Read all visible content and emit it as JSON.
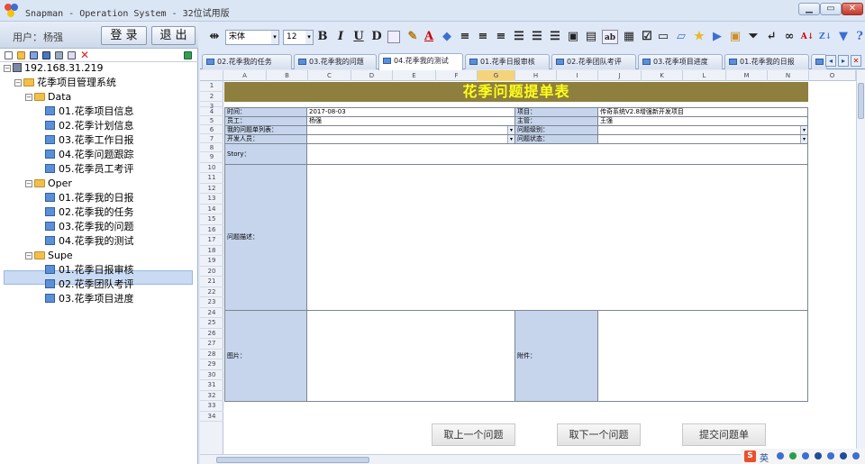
{
  "window": {
    "title": "Snapman - Operation System - 32位试用版",
    "minimize": "▭",
    "maximize": "▭",
    "close": "✕"
  },
  "login": {
    "user_label": "用户：",
    "user_name": "杨强",
    "login_btn": "登 录",
    "logout_btn": "退 出"
  },
  "tree": {
    "root": "192.168.31.219",
    "system": "花季项目管理系统",
    "groups": [
      {
        "name": "Data",
        "items": [
          "01.花季项目信息",
          "02.花季计划信息",
          "03.花季工作日报",
          "04.花季问题跟踪",
          "05.花季员工考评"
        ]
      },
      {
        "name": "Oper",
        "items": [
          "01.花季我的日报",
          "02.花季我的任务",
          "03.花季我的问题",
          "04.花季我的测试"
        ]
      },
      {
        "name": "Supe",
        "items": [
          "01.花季日报审核",
          "02.花季团队考评",
          "03.花季项目进度"
        ]
      }
    ]
  },
  "toolbar": {
    "font_name": "宋体",
    "font_size": "12",
    "bold": "B",
    "italic": "I",
    "underline": "U",
    "strike": "D",
    "font_color": "A",
    "abbr": "ab"
  },
  "tabs": [
    "02.花季我的任务",
    "03.花季我的问题",
    "04.花季我的测试",
    "01.花季日报审核",
    "02.花季团队考评",
    "03.花季项目进度",
    "01.花季我的日报"
  ],
  "sheet": {
    "columns": [
      "A",
      "B",
      "C",
      "D",
      "E",
      "F",
      "G",
      "H",
      "I",
      "J",
      "K",
      "L",
      "M",
      "N",
      "O"
    ],
    "selected_column": "G",
    "rows": [
      "1",
      "2",
      "3",
      "4",
      "5",
      "6",
      "7",
      "8",
      "9",
      "10",
      "11",
      "12",
      "13",
      "14",
      "15",
      "16",
      "17",
      "18",
      "19",
      "20",
      "21",
      "22",
      "23",
      "24",
      "25",
      "26",
      "27",
      "28",
      "29",
      "30",
      "31",
      "32",
      "33",
      "34"
    ],
    "form_title": "花季问题提单表",
    "fields": {
      "time_label": "时间：",
      "time_value": "2017-08-03",
      "project_label": "项目：",
      "project_value": "传奇系统V2.8增强新开发项目",
      "staff_label": "员工：",
      "staff_value": "杨强",
      "manager_label": "主管：",
      "manager_value": "王强",
      "myissues_label": "我的问题单列表：",
      "myissues_value": "",
      "level_label": "问题级别：",
      "level_value": "",
      "dev_label": "开发人员：",
      "dev_value": "",
      "status_label": "问题状态：",
      "status_value": "",
      "story_label": "Story：",
      "story_value": "",
      "desc_label": "问题描述：",
      "desc_value": "",
      "image_label": "图片：",
      "attach_label": "附件："
    },
    "buttons": {
      "prev": "取上一个问题",
      "next": "取下一个问题",
      "submit": "提交问题单"
    }
  },
  "tray": {
    "ime_logo": "S",
    "ime_lang": "英"
  }
}
